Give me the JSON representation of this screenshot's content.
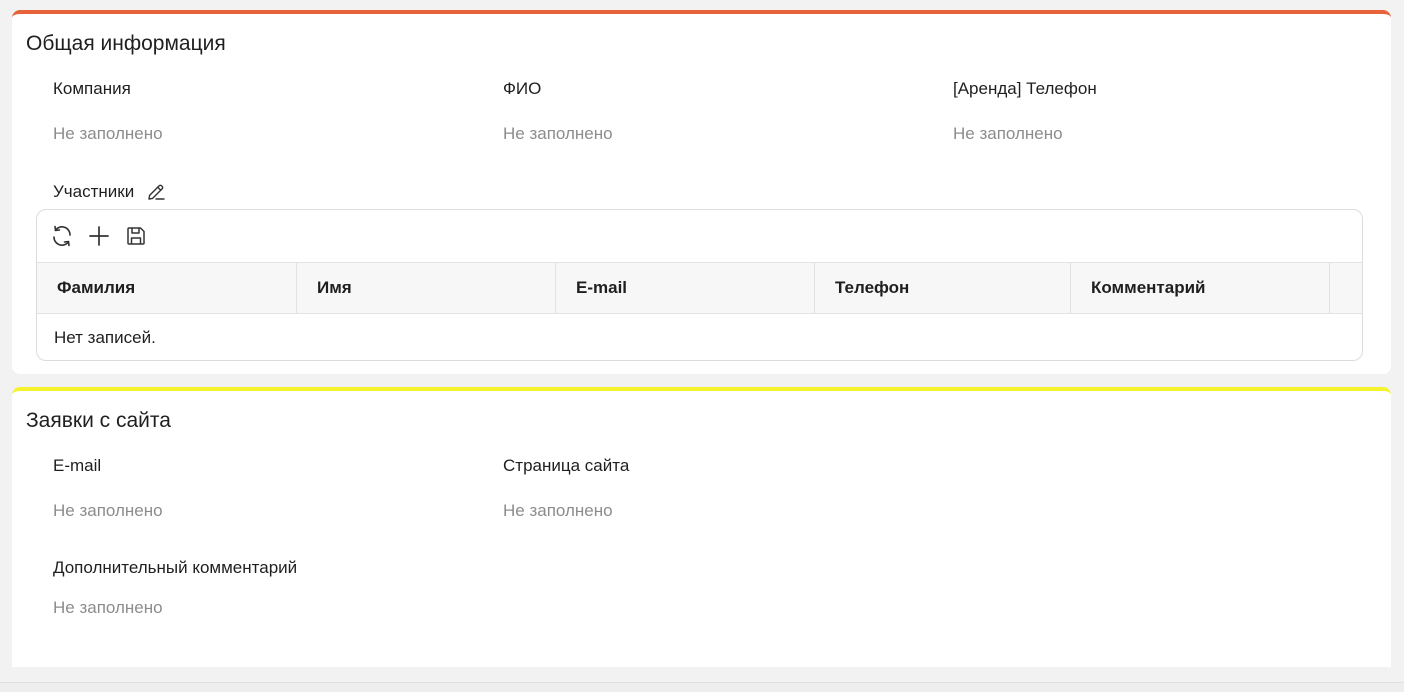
{
  "general_info": {
    "title": "Общая информация",
    "accent_color": "#e8633a",
    "fields": [
      {
        "label": "Компания",
        "value": "Не заполнено"
      },
      {
        "label": "ФИО",
        "value": "Не заполнено"
      },
      {
        "label": "[Аренда] Телефон",
        "value": "Не заполнено"
      }
    ],
    "participants": {
      "label": "Участники",
      "edit_icon": "pencil-icon",
      "toolbar": {
        "refresh_icon": "refresh-icon",
        "add_icon": "plus-icon",
        "save_icon": "save-icon"
      },
      "columns": [
        "Фамилия",
        "Имя",
        "E-mail",
        "Телефон",
        "Комментарий"
      ],
      "rows": [],
      "empty_text": "Нет записей."
    }
  },
  "site_requests": {
    "title": "Заявки с сайта",
    "accent_color": "#f6f22c",
    "fields": [
      {
        "label": "E-mail",
        "value": "Не заполнено"
      },
      {
        "label": "Страница сайта",
        "value": "Не заполнено"
      },
      {
        "label": "Дополнительный комментарий",
        "value": "Не заполнено"
      }
    ]
  }
}
